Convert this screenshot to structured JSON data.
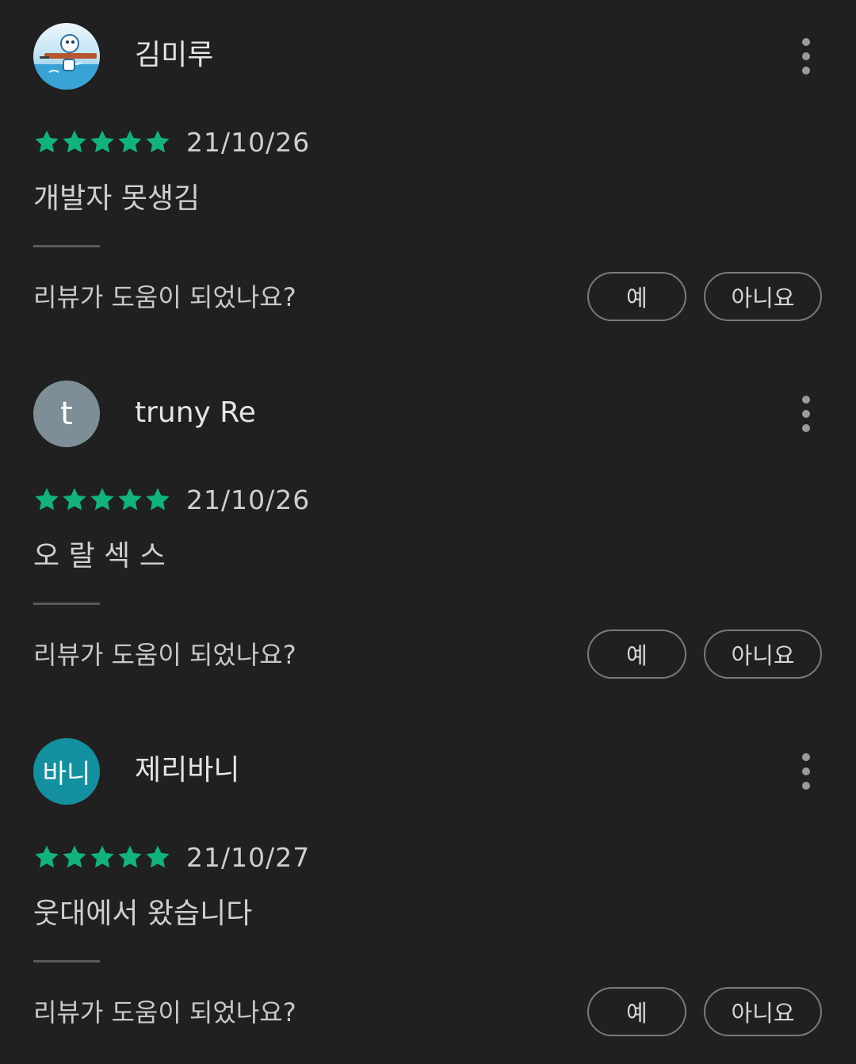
{
  "theme": {
    "background": "#202020",
    "star_color": "#10b37d",
    "avatar_gray": "#7e8e97",
    "avatar_teal": "#13909f"
  },
  "reviews": [
    {
      "username": "김미루",
      "avatar": {
        "type": "image",
        "icon": "profile-photo-icon"
      },
      "rating": 5,
      "date": "21/10/26",
      "text": "개발자 못생김",
      "helpful_question": "리뷰가 도움이 되었나요?",
      "yes_label": "예",
      "no_label": "아니요"
    },
    {
      "username": "truny Re",
      "avatar": {
        "type": "letter",
        "text": "t",
        "color": "#7e8e97"
      },
      "rating": 5,
      "date": "21/10/26",
      "text": "오 랄 섹 스",
      "helpful_question": "리뷰가 도움이 되었나요?",
      "yes_label": "예",
      "no_label": "아니요"
    },
    {
      "username": "제리바니",
      "avatar": {
        "type": "text",
        "text": "바니",
        "color": "#13909f"
      },
      "rating": 5,
      "date": "21/10/27",
      "text": "웃대에서 왔습니다",
      "helpful_question": "리뷰가 도움이 되었나요?",
      "yes_label": "예",
      "no_label": "아니요"
    }
  ]
}
